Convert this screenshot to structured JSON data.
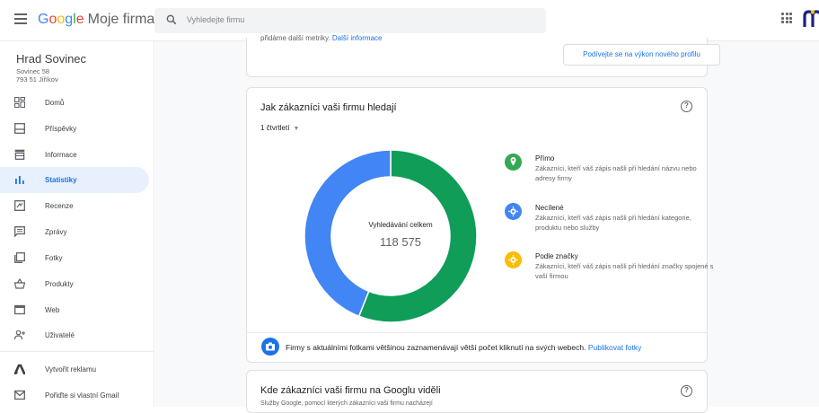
{
  "topbar": {
    "logo": {
      "g1": "G",
      "g2": "o",
      "g3": "o",
      "g4": "g",
      "g5": "l",
      "g6": "e",
      "product": "Moje firma"
    },
    "search_placeholder": "Vyhledejte firmu"
  },
  "business": {
    "name": "Hrad Sovinec",
    "address_line1": "Sovinec 58",
    "address_line2": "793 51 Jiříkov"
  },
  "sidebar": {
    "items": [
      {
        "label": "Domů",
        "icon": "home-grid-icon"
      },
      {
        "label": "Příspěvky",
        "icon": "posts-icon"
      },
      {
        "label": "Informace",
        "icon": "store-info-icon"
      },
      {
        "label": "Statistiky",
        "icon": "bar-chart-icon",
        "active": true
      },
      {
        "label": "Recenze",
        "icon": "review-icon"
      },
      {
        "label": "Zprávy",
        "icon": "message-icon"
      },
      {
        "label": "Fotky",
        "icon": "photo-icon"
      },
      {
        "label": "Produkty",
        "icon": "basket-icon"
      },
      {
        "label": "Web",
        "icon": "web-icon"
      },
      {
        "label": "Uživatelé",
        "icon": "add-user-icon"
      },
      {
        "label": "Vytvořit reklamu",
        "icon": "ads-icon"
      },
      {
        "label": "Pořiďte si vlastní Gmail",
        "icon": "mail-icon"
      }
    ]
  },
  "top_card": {
    "cut_text": "přidáme další metriky.",
    "cut_link": "Další informace",
    "button": "Podívejte se na výkon nového profilu"
  },
  "search_card": {
    "title": "Jak zákazníci vaši firmu hledají",
    "period": "1 čtvrtletí",
    "total_label": "Vyhledávání celkem",
    "total_value": "118 575",
    "legend": [
      {
        "title": "Přímo",
        "desc": "Zákazníci, kteří váš zápis našli při hledání názvu nebo adresy firmy",
        "color": "#34a853",
        "icon": "location-pin-icon"
      },
      {
        "title": "Necílené",
        "desc": "Zákazníci, kteří váš zápis našli při hledání kategorie, produktu nebo služby",
        "color": "#4285f4",
        "icon": "discovery-icon"
      },
      {
        "title": "Podle značky",
        "desc": "Zákazníci, kteří váš zápis našli při hledání značky spojené s vaší firmou",
        "color": "#fbbc05",
        "icon": "brand-icon"
      }
    ],
    "tip_text": "Firmy s aktuálními fotkami většinou zaznamenávají větší počet kliknutí na svých webech.",
    "tip_link": "Publikovat fotky"
  },
  "chart_data": {
    "type": "pie",
    "categories": [
      "Přímo",
      "Necílené",
      "Podle značky"
    ],
    "values": [
      0.56,
      0.44,
      0.0
    ],
    "colors": [
      "#0f9d58",
      "#4285f4",
      "#fbbc05"
    ]
  },
  "bottom_card": {
    "title": "Kde zákazníci vaši firmu na Googlu viděli",
    "sub": "Služby Google, pomocí kterých zákazníci vaši firmu nacházejí"
  }
}
